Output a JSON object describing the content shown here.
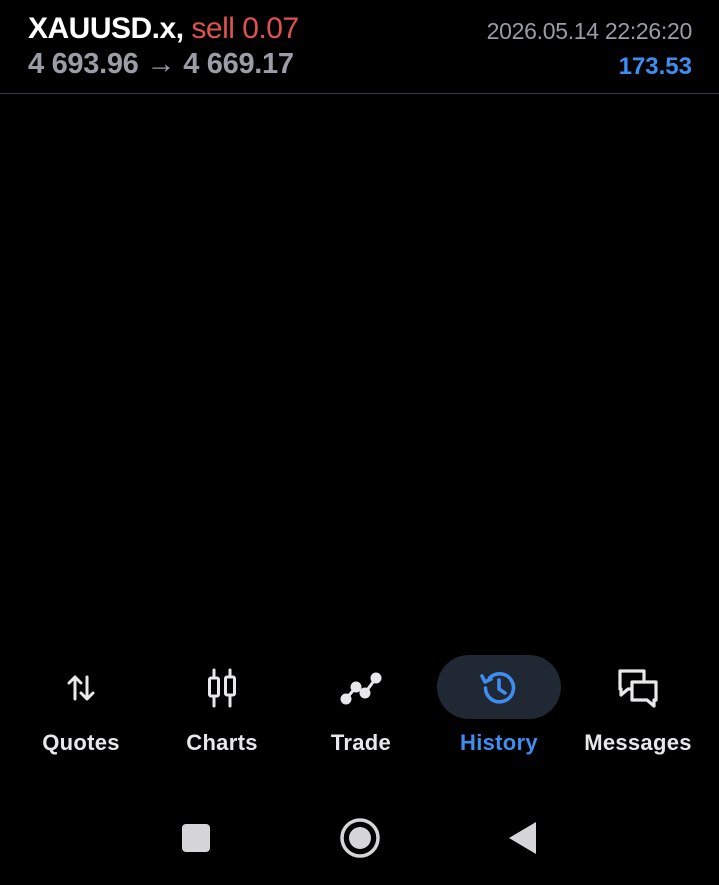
{
  "header": {
    "symbol": "XAUUSD.x,",
    "side": "sell 0.07",
    "open_price": "4 693.96",
    "arrow": "→",
    "current_price": "4 669.17",
    "datetime": "2026.05.14 22:26:20",
    "profit": "173.53"
  },
  "colors": {
    "background": "#000000",
    "sell": "#e0514f",
    "accent": "#3d8ef0",
    "muted": "#9a9da6",
    "active_tab_bg": "#1f2833"
  },
  "tabs": [
    {
      "label": "Quotes",
      "icon": "up-down-arrows-icon",
      "active": false
    },
    {
      "label": "Charts",
      "icon": "candlesticks-icon",
      "active": false
    },
    {
      "label": "Trade",
      "icon": "trend-line-icon",
      "active": false
    },
    {
      "label": "History",
      "icon": "history-clock-icon",
      "active": true
    },
    {
      "label": "Messages",
      "icon": "chat-bubbles-icon",
      "active": false
    }
  ],
  "system_nav": [
    {
      "icon": "recents-square-icon"
    },
    {
      "icon": "home-circle-icon"
    },
    {
      "icon": "back-triangle-icon"
    }
  ]
}
